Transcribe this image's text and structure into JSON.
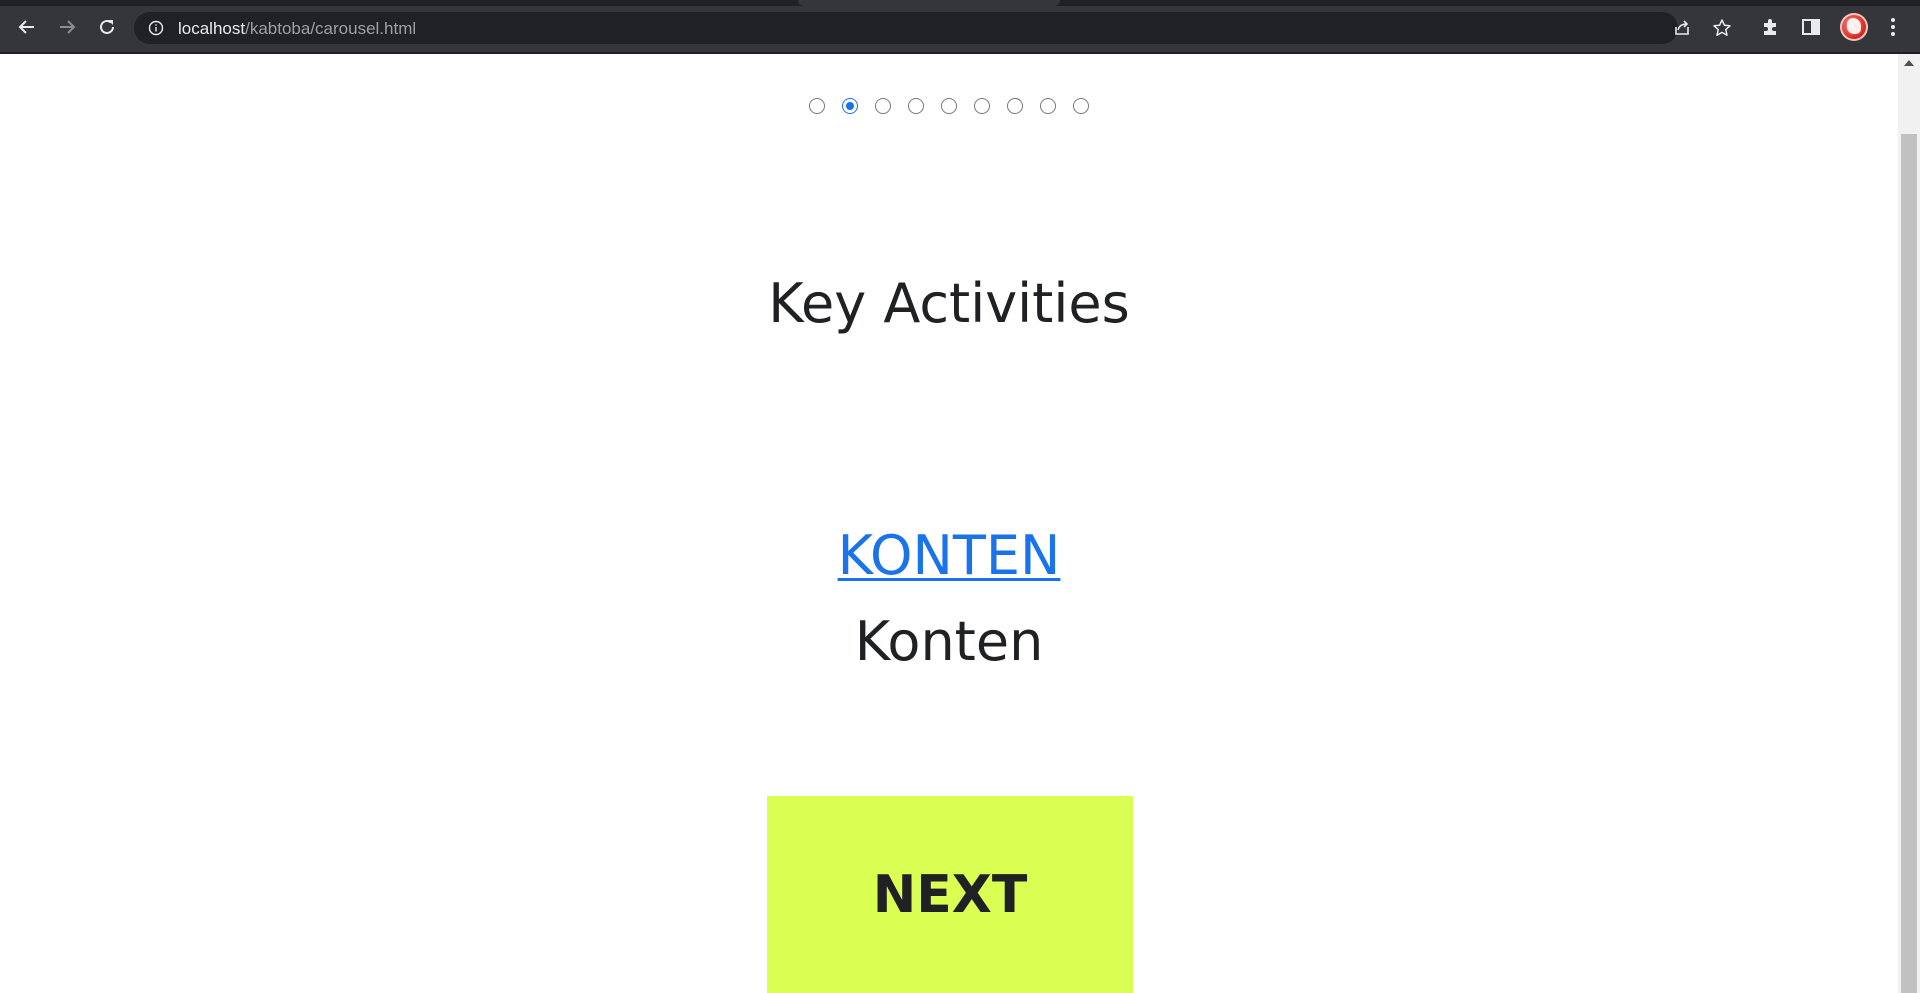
{
  "browser": {
    "url_host": "localhost",
    "url_path": "/kabtoba/carousel.html"
  },
  "icons": {
    "back": "back-arrow-icon",
    "forward": "forward-arrow-icon",
    "reload": "reload-icon",
    "site_info": "info-icon",
    "share": "share-icon",
    "bookmark": "star-icon",
    "extensions": "puzzle-icon",
    "side_panel": "side-panel-icon",
    "profile": "avatar",
    "menu": "kebab-menu-icon"
  },
  "carousel": {
    "dot_count": 9,
    "selected_index": 1
  },
  "slide": {
    "title": "Key Activities",
    "link_text": "KONTEN",
    "subtitle": "Konten",
    "next_label": "NEXT"
  },
  "colors": {
    "accent": "#1a73e8",
    "next_button": "#dbfe52",
    "toolbar": "#35363a",
    "omnibox": "#202124"
  }
}
